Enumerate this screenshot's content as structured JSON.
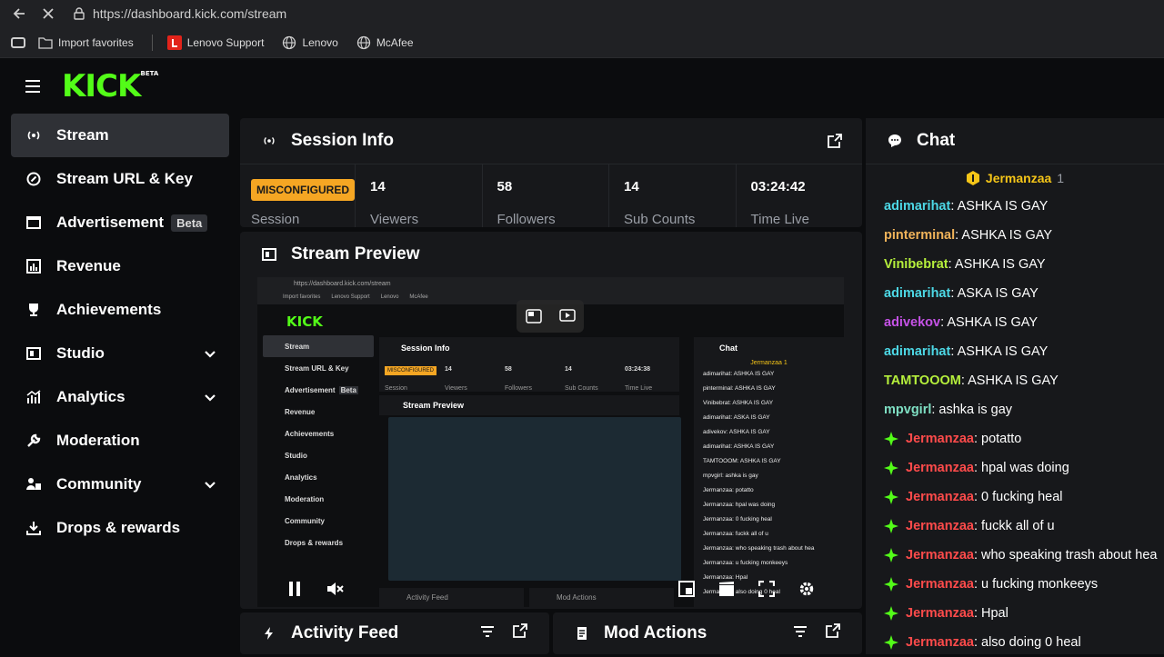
{
  "browser": {
    "url": "https://dashboard.kick.com/stream",
    "bookmarks": [
      {
        "label": "Import favorites"
      },
      {
        "label": "Lenovo Support"
      },
      {
        "label": "Lenovo"
      },
      {
        "label": "McAfee"
      }
    ]
  },
  "app": {
    "logo": "KICK",
    "logo_badge": "BETA"
  },
  "sidebar": {
    "items": [
      {
        "label": "Stream",
        "icon": "broadcast-icon",
        "active": true
      },
      {
        "label": "Stream URL & Key",
        "icon": "link-icon"
      },
      {
        "label": "Advertisement",
        "icon": "ad-icon",
        "badge": "Beta"
      },
      {
        "label": "Revenue",
        "icon": "chart-icon"
      },
      {
        "label": "Achievements",
        "icon": "trophy-icon"
      },
      {
        "label": "Studio",
        "icon": "studio-icon",
        "expandable": true
      },
      {
        "label": "Analytics",
        "icon": "analytics-icon",
        "expandable": true
      },
      {
        "label": "Moderation",
        "icon": "wrench-icon"
      },
      {
        "label": "Community",
        "icon": "people-icon",
        "expandable": true
      },
      {
        "label": "Drops & rewards",
        "icon": "drops-icon"
      }
    ]
  },
  "session": {
    "title": "Session Info",
    "status": "MISCONFIGURED",
    "status_label": "Session",
    "stats": [
      {
        "value": "14",
        "label": "Viewers"
      },
      {
        "value": "58",
        "label": "Followers"
      },
      {
        "value": "14",
        "label": "Sub Counts"
      },
      {
        "value": "03:24:42",
        "label": "Time Live"
      }
    ]
  },
  "preview": {
    "title": "Stream Preview",
    "mini": {
      "url": "https://dashboard.kick.com/stream",
      "bookmarks": [
        "Import favorites",
        "Lenovo Support",
        "Lenovo",
        "McAfee"
      ],
      "logo": "KICK",
      "side_items": [
        "Stream",
        "Stream URL & Key",
        "Advertisement",
        "Revenue",
        "Achievements",
        "Studio",
        "Analytics",
        "Moderation",
        "Community",
        "Drops & rewards"
      ],
      "beta": "Beta",
      "session_title": "Session Info",
      "status": "MISCONFIGURED",
      "status_label": "Session",
      "stats": [
        {
          "value": "14",
          "label": "Viewers"
        },
        {
          "value": "58",
          "label": "Followers"
        },
        {
          "value": "14",
          "label": "Sub Counts"
        },
        {
          "value": "03:24:38",
          "label": "Time Live"
        }
      ],
      "preview_title": "Stream Preview",
      "chat_title": "Chat",
      "pinned": "Jermanzaa 1",
      "lines": [
        "adimarihat: ASHKA IS GAY",
        "pinterminal: ASHKA IS GAY",
        "Vinibebrat: ASHKA IS GAY",
        "adimarihat: ASKA IS GAY",
        "adivekov: ASHKA IS GAY",
        "adimarihat: ASHKA IS GAY",
        "TAMTOOOM: ASHKA IS GAY",
        "mpvgirl: ashka is gay",
        "Jermanzaa: potatto",
        "Jermanzaa: hpal was doing",
        "Jermanzaa: 0 fucking heal",
        "Jermanzaa: fuckk all of u",
        "Jermanzaa: who speaking trash about hea",
        "Jermanzaa: u fucking monkeeys",
        "Jermanzaa: Hpal",
        "Jermanzaa: also doing 0 heal"
      ],
      "bottom": [
        "Activity Feed",
        "Mod Actions"
      ]
    }
  },
  "activity": {
    "title": "Activity Feed"
  },
  "mod_actions": {
    "title": "Mod Actions"
  },
  "chat": {
    "title": "Chat",
    "pinned_user": "Jermanzaa",
    "pinned_count": "1",
    "messages": [
      {
        "user": "adimarihat",
        "text": ": ASHKA IS GAY",
        "color": "#4dd8e6",
        "badge": false
      },
      {
        "user": "pinterminal",
        "text": ": ASHKA IS GAY",
        "color": "#f0b35a",
        "badge": false
      },
      {
        "user": "Vinibebrat",
        "text": ": ASHKA IS GAY",
        "color": "#b6f03c",
        "badge": false
      },
      {
        "user": "adimarihat",
        "text": ": ASKA IS GAY",
        "color": "#4dd8e6",
        "badge": false
      },
      {
        "user": "adivekov",
        "text": ": ASHKA IS GAY",
        "color": "#c552e6",
        "badge": false
      },
      {
        "user": "adimarihat",
        "text": ": ASHKA IS GAY",
        "color": "#4dd8e6",
        "badge": false
      },
      {
        "user": "TAMTOOOM",
        "text": ": ASHKA IS GAY",
        "color": "#b6f03c",
        "badge": false
      },
      {
        "user": "mpvgirl",
        "text": ": ashka is gay",
        "color": "#7fe0c4",
        "badge": false
      },
      {
        "user": "Jermanzaa",
        "text": ": potatto",
        "color": "#ff4b4b",
        "badge": true
      },
      {
        "user": "Jermanzaa",
        "text": ": hpal was doing",
        "color": "#ff4b4b",
        "badge": true
      },
      {
        "user": "Jermanzaa",
        "text": ": 0 fucking heal",
        "color": "#ff4b4b",
        "badge": true
      },
      {
        "user": "Jermanzaa",
        "text": ": fuckk all of u",
        "color": "#ff4b4b",
        "badge": true
      },
      {
        "user": "Jermanzaa",
        "text": ": who speaking trash about hea",
        "color": "#ff4b4b",
        "badge": true
      },
      {
        "user": "Jermanzaa",
        "text": ": u fucking monkeeys",
        "color": "#ff4b4b",
        "badge": true
      },
      {
        "user": "Jermanzaa",
        "text": ": Hpal",
        "color": "#ff4b4b",
        "badge": true
      },
      {
        "user": "Jermanzaa",
        "text": ": also doing 0 heal",
        "color": "#ff4b4b",
        "badge": true
      }
    ]
  },
  "colors": {
    "accent": "#53fc18",
    "warning": "#f5a623",
    "panel": "#17181b"
  }
}
